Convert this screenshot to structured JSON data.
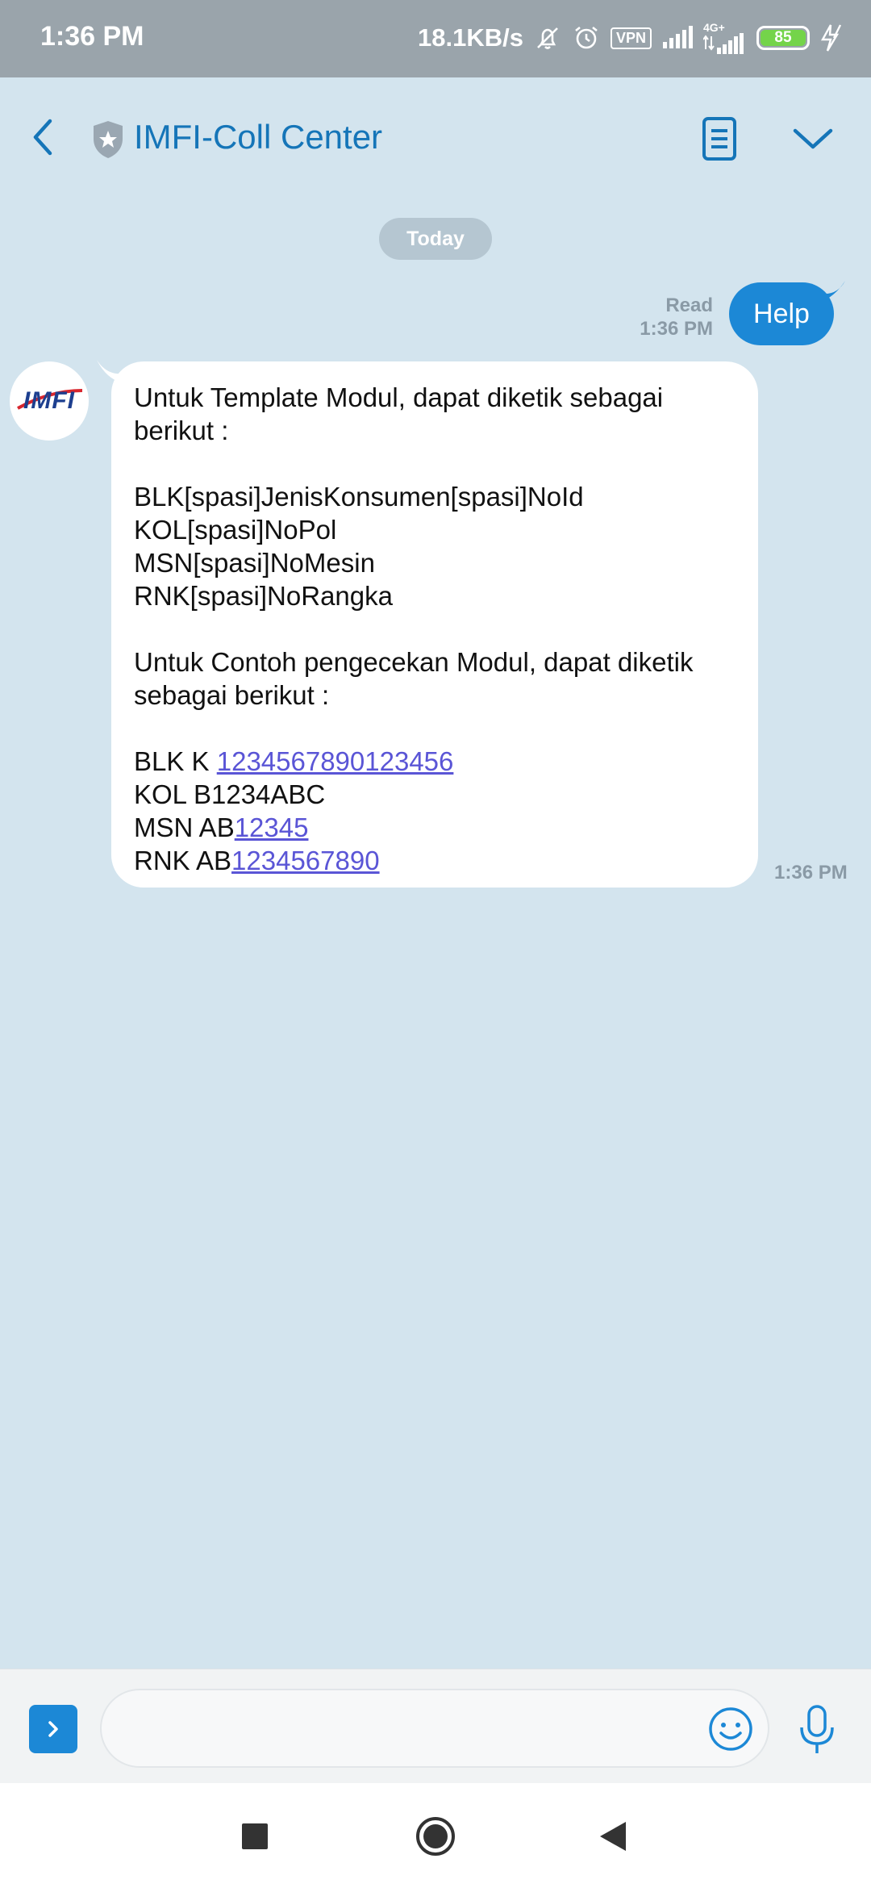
{
  "status_bar": {
    "time": "1:36 PM",
    "network_speed": "18.1KB/s",
    "vpn_label": "VPN",
    "network_type": "4G+",
    "battery_level": "85",
    "icons": [
      "muted-bell-icon",
      "alarm-icon",
      "vpn-icon",
      "signal-icon",
      "signal-4g-icon",
      "battery-icon",
      "charging-icon"
    ]
  },
  "header": {
    "title": "IMFI-Coll Center",
    "icons": [
      "back-arrow-icon",
      "verified-shield-icon",
      "document-list-icon",
      "chevron-down-icon"
    ],
    "accent_color": "#1575b8"
  },
  "chat": {
    "date_label": "Today",
    "outgoing": {
      "text": "Help",
      "status": "Read",
      "time": "1:36 PM",
      "bubble_color": "#1c88d6"
    },
    "incoming": {
      "avatar_text": "IMFI",
      "intro": "Untuk Template Modul, dapat diketik sebagai berikut :",
      "template_lines": [
        "BLK[spasi]JenisKonsumen[spasi]NoId",
        "KOL[spasi]NoPol",
        "MSN[spasi]NoMesin",
        "RNK[spasi]NoRangka"
      ],
      "example_intro": "Untuk Contoh pengecekan Modul, dapat diketik sebagai berikut :",
      "examples": [
        {
          "prefix": "BLK K ",
          "link": "1234567890123456"
        },
        {
          "prefix": "KOL B1234ABC",
          "link": ""
        },
        {
          "prefix": "MSN AB",
          "link": "12345"
        },
        {
          "prefix": "RNK AB",
          "link": "1234567890"
        }
      ],
      "time": "1:36 PM",
      "link_color": "#5a55d6"
    }
  },
  "input_bar": {
    "placeholder": "",
    "icons": [
      "expand-icon",
      "emoji-icon",
      "microphone-icon"
    ]
  },
  "nav_bar": {
    "icons": [
      "recent-apps-icon",
      "home-icon",
      "back-icon"
    ]
  }
}
